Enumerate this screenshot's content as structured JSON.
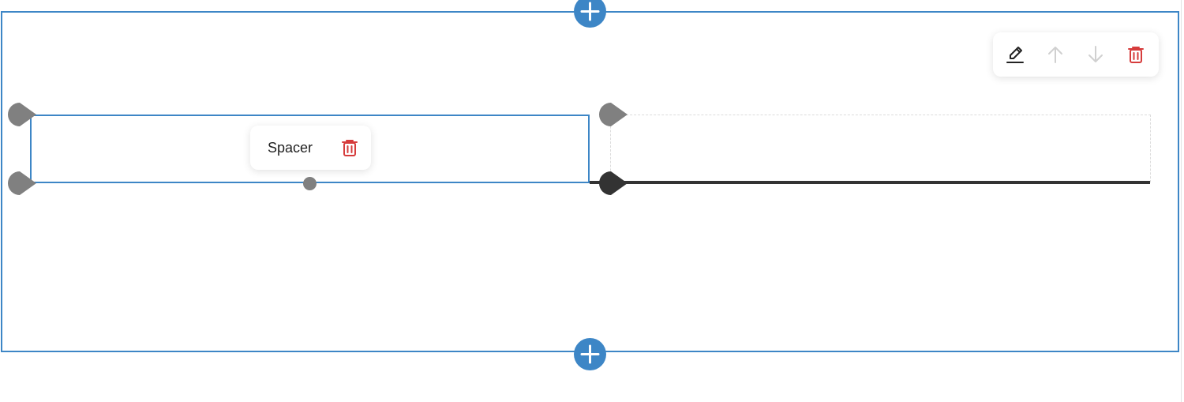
{
  "spacer_widget": {
    "label": "Spacer"
  },
  "toolbar": {
    "icons": [
      "pencil-edit-icon",
      "arrow-up-icon",
      "arrow-down-icon",
      "trash-icon"
    ]
  },
  "colors": {
    "accent": "#3d86c6",
    "delete": "#d63c3c",
    "disabled": "#d0d0d0",
    "handle": "#808080",
    "divider": "#333333"
  }
}
